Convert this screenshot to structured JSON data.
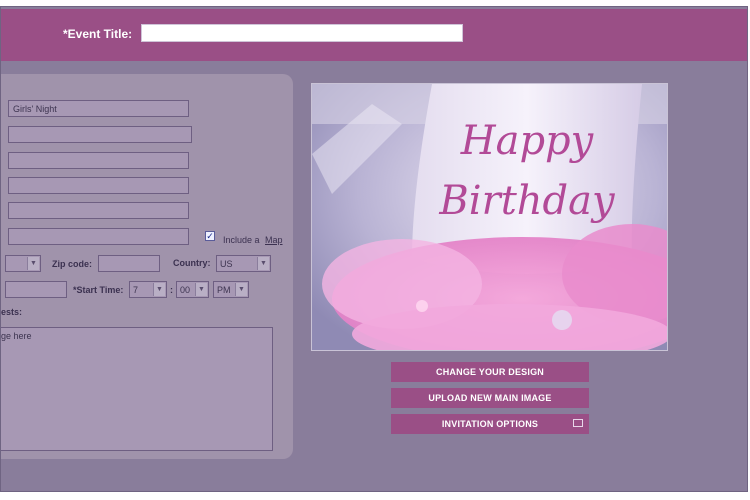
{
  "header": {
    "event_title_label": "*Event Title:",
    "event_title_value": ""
  },
  "form": {
    "host_value": "Girls' Night",
    "include_map_label": "Include a",
    "include_map_link": "Map",
    "include_map_checked": true,
    "zip_label": "Zip code:",
    "country_label": "Country:",
    "country_value": "US",
    "start_time_label": "*Start Time:",
    "start_hour": "7",
    "start_minute": "00",
    "start_ampm": "PM",
    "message_label_partial": "ests:",
    "message_placeholder_partial": "age here"
  },
  "image": {
    "hat_text_line1": "Happy",
    "hat_text_line2": "Birthday"
  },
  "actions": {
    "change_design": "CHANGE YOUR DESIGN",
    "upload_image": "UPLOAD NEW MAIN IMAGE",
    "invitation_options": "INVITATION OPTIONS"
  },
  "colors": {
    "header_bar": "#9a4f86",
    "background": "#897d9b",
    "panel": "#a093ab",
    "button": "#9a4f86"
  },
  "icons": {
    "check": "checkmark",
    "dropdown": "chevron-down-icon",
    "options": "envelope-icon"
  }
}
